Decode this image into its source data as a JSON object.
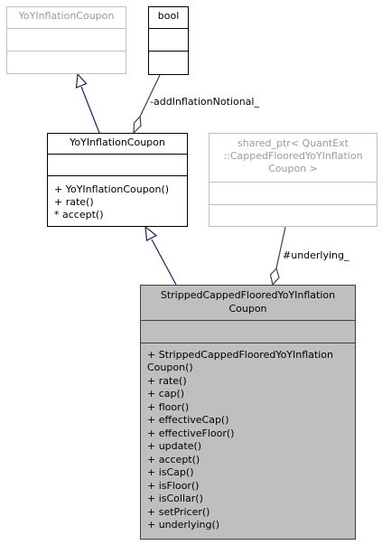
{
  "nodes": {
    "base_coupon": {
      "title": "YoYInflationCoupon"
    },
    "bool_type": {
      "title": "bool"
    },
    "coupon": {
      "title": "YoYInflationCoupon",
      "methods": [
        "+ YoYInflationCoupon()",
        "+ rate()",
        "* accept()"
      ]
    },
    "shared_ptr": {
      "title_lines": [
        "shared_ptr< QuantExt",
        "::CappedFlooredYoYInflation",
        "Coupon >"
      ]
    },
    "stripped": {
      "title_lines": [
        "StrippedCappedFlooredYoYInflation",
        "Coupon"
      ],
      "methods": [
        "+ StrippedCappedFlooredYoYInflation",
        "Coupon()",
        "+ rate()",
        "+ cap()",
        "+ floor()",
        "+ effectiveCap()",
        "+ effectiveFloor()",
        "+ update()",
        "+ accept()",
        "+ isCap()",
        "+ isFloor()",
        "+ isCollar()",
        "+ setPricer()",
        "+ underlying()"
      ]
    }
  },
  "edges": {
    "add_inflation_notional": "-addInflationNotional_",
    "underlying": "#underlying_"
  },
  "colors": {
    "inheritance_arrow": "#191970",
    "usage_arrow": "#404040",
    "main_fill": "#bfbfbf",
    "grey_border": "#bfbfbf"
  }
}
